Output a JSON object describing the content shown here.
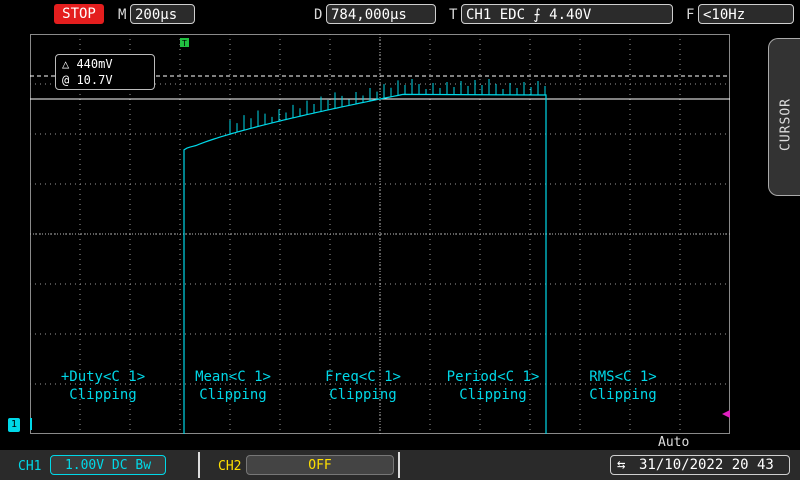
{
  "top": {
    "run_state": "STOP",
    "timebase_label": "M",
    "timebase_value": "200µs",
    "delay_label": "D",
    "delay_value": "784,000µs",
    "trigger_label": "T",
    "trigger_value": "CH1 EDC ⨍ 4.40V",
    "freq_label": "F",
    "freq_value": "<10Hz"
  },
  "softkey": {
    "label": "CURSOR"
  },
  "cursor_readout": {
    "delta": "△ 440mV",
    "at": "@ 10.7V"
  },
  "measurements": [
    {
      "name": "+Duty<C 1>",
      "status": "Clipping"
    },
    {
      "name": "Mean<C 1>",
      "status": "Clipping"
    },
    {
      "name": "Freq<C 1>",
      "status": "Clipping"
    },
    {
      "name": "Period<C 1>",
      "status": "Clipping"
    },
    {
      "name": "RMS<C 1>",
      "status": "Clipping"
    }
  ],
  "trigger_marker": "T",
  "ch1_marker": "1",
  "trigger_mode": "Auto",
  "bottom": {
    "ch1_label": "CH1",
    "ch1_setting": "1.00V DC Bw",
    "ch2_label": "CH2",
    "ch2_setting": "OFF",
    "datetime": "31/10/2022 20 43"
  },
  "colors": {
    "ch1": "#00d8e8",
    "ch2": "#ffe000",
    "stop": "#e41e1e",
    "trigger_marker": "#20c040"
  }
}
